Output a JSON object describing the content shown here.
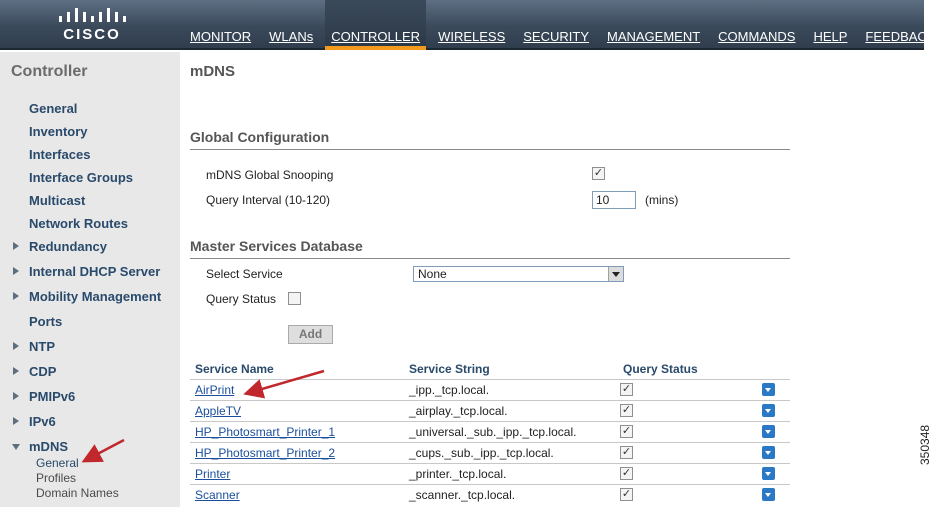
{
  "brand": {
    "name": "CISCO"
  },
  "nav": [
    {
      "label": "MONITOR",
      "active": false
    },
    {
      "label": "WLANs",
      "active": false
    },
    {
      "label": "CONTROLLER",
      "active": true
    },
    {
      "label": "WIRELESS",
      "active": false
    },
    {
      "label": "SECURITY",
      "active": false
    },
    {
      "label": "MANAGEMENT",
      "active": false
    },
    {
      "label": "COMMANDS",
      "active": false
    },
    {
      "label": "HELP",
      "active": false
    },
    {
      "label": "FEEDBACK",
      "active": false
    }
  ],
  "sidebar": {
    "title": "Controller",
    "items": [
      {
        "label": "General"
      },
      {
        "label": "Inventory"
      },
      {
        "label": "Interfaces"
      },
      {
        "label": "Interface Groups"
      },
      {
        "label": "Multicast"
      },
      {
        "label": "Network Routes"
      },
      {
        "label": "Redundancy"
      },
      {
        "label": "Internal DHCP Server"
      },
      {
        "label": "Mobility Management"
      },
      {
        "label": "Ports"
      },
      {
        "label": "NTP"
      },
      {
        "label": "CDP"
      },
      {
        "label": "PMIPv6"
      },
      {
        "label": "IPv6"
      },
      {
        "label": "mDNS"
      }
    ],
    "mdns_sub": [
      "General",
      "Profiles",
      "Domain Names"
    ]
  },
  "main": {
    "title": "mDNS",
    "global": {
      "heading": "Global Configuration",
      "snooping_label": "mDNS Global Snooping",
      "snooping_checked": true,
      "interval_label": "Query Interval (10-120)",
      "interval_value": "10",
      "interval_unit": "(mins)"
    },
    "master": {
      "heading": "Master Services Database",
      "select_label": "Select Service",
      "select_value": "None",
      "query_status_label": "Query Status",
      "query_status_checked": false,
      "add_label": "Add"
    },
    "table": {
      "headers": [
        "Service Name",
        "Service String",
        "Query Status"
      ],
      "rows": [
        {
          "name": "AirPrint",
          "string": "_ipp._tcp.local.",
          "query": true
        },
        {
          "name": "AppleTV",
          "string": "_airplay._tcp.local.",
          "query": true
        },
        {
          "name": "HP_Photosmart_Printer_1",
          "string": "_universal._sub._ipp._tcp.local.",
          "query": true
        },
        {
          "name": "HP_Photosmart_Printer_2",
          "string": "_cups._sub._ipp._tcp.local.",
          "query": true
        },
        {
          "name": "Printer",
          "string": "_printer._tcp.local.",
          "query": true
        },
        {
          "name": "Scanner",
          "string": "_scanner._tcp.local.",
          "query": true
        }
      ]
    }
  },
  "figure_number": "350348",
  "check_mark": "✓"
}
